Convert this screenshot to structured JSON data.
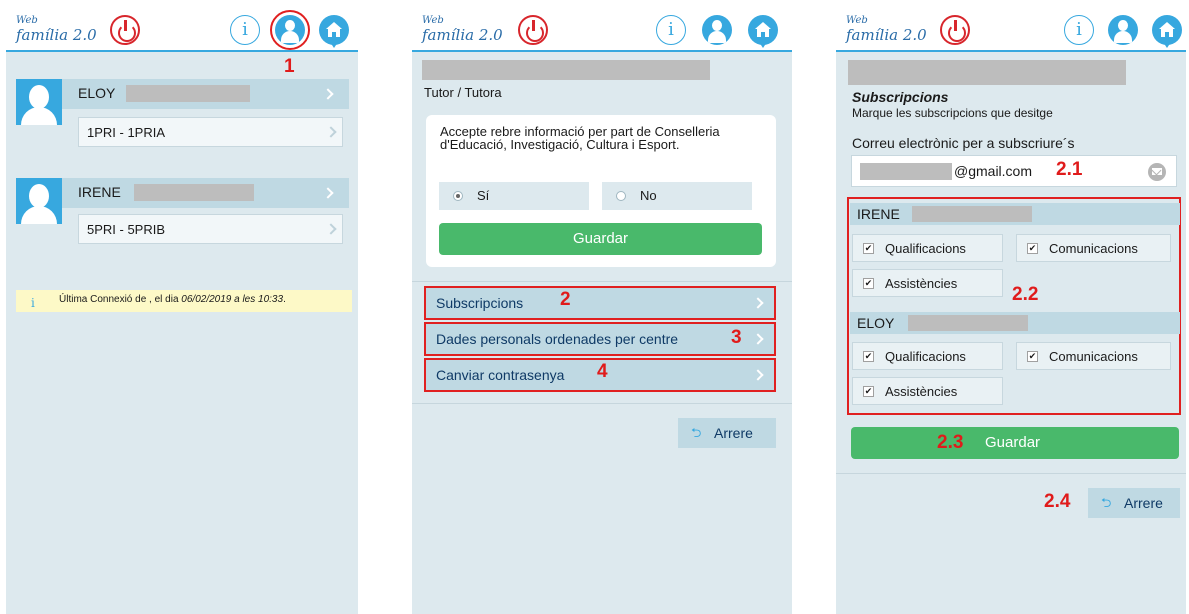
{
  "brand": {
    "web": "Web",
    "name": "família 2.0"
  },
  "panel1": {
    "annotation": "1",
    "students": [
      {
        "name": "ELOY",
        "class": "1PRI - 1PRIA"
      },
      {
        "name": "IRENE",
        "class": "5PRI - 5PRIB"
      }
    ],
    "last_connection": {
      "icon": "i",
      "prefix": "Última Connexió de , el dia ",
      "date": "06/02/2019 a les 10:33",
      "suffix": "."
    }
  },
  "panel2": {
    "role": "Tutor / Tutora",
    "consent_text": "Accepte rebre informació per part de Conselleria d'Educació, Investigació, Cultura i Esport.",
    "options": [
      "Sí",
      "No"
    ],
    "selected_option": "Sí",
    "save_label": "Guardar",
    "menu": [
      {
        "label": "Subscripcions",
        "annotation": "2"
      },
      {
        "label": "Dades personals ordenades per centre",
        "annotation": "3"
      },
      {
        "label": "Canviar contrasenya",
        "annotation": "4"
      }
    ],
    "back_label": "Arrere"
  },
  "panel3": {
    "title": "Subscripcions",
    "subtitle": "Marque les subscripcions que desitge",
    "email_label": "Correu electrònic per a subscriure´s",
    "email_domain": "@gmail.com",
    "annotations": {
      "email": "2.1",
      "groups": "2.2",
      "save": "2.3",
      "back": "2.4"
    },
    "groups": [
      {
        "name": "IRENE",
        "items": [
          {
            "label": "Qualificacions",
            "checked": true
          },
          {
            "label": "Comunicacions",
            "checked": true
          },
          {
            "label": "Assistències",
            "checked": true
          }
        ]
      },
      {
        "name": "ELOY",
        "items": [
          {
            "label": "Qualificacions",
            "checked": true
          },
          {
            "label": "Comunicacions",
            "checked": true
          },
          {
            "label": "Assistències",
            "checked": true
          }
        ]
      }
    ],
    "save_label": "Guardar",
    "back_label": "Arrere"
  },
  "colors": {
    "accent": "#37a8df",
    "power": "#d8262c",
    "save": "#49b96b",
    "annotation": "#e01b1b"
  }
}
